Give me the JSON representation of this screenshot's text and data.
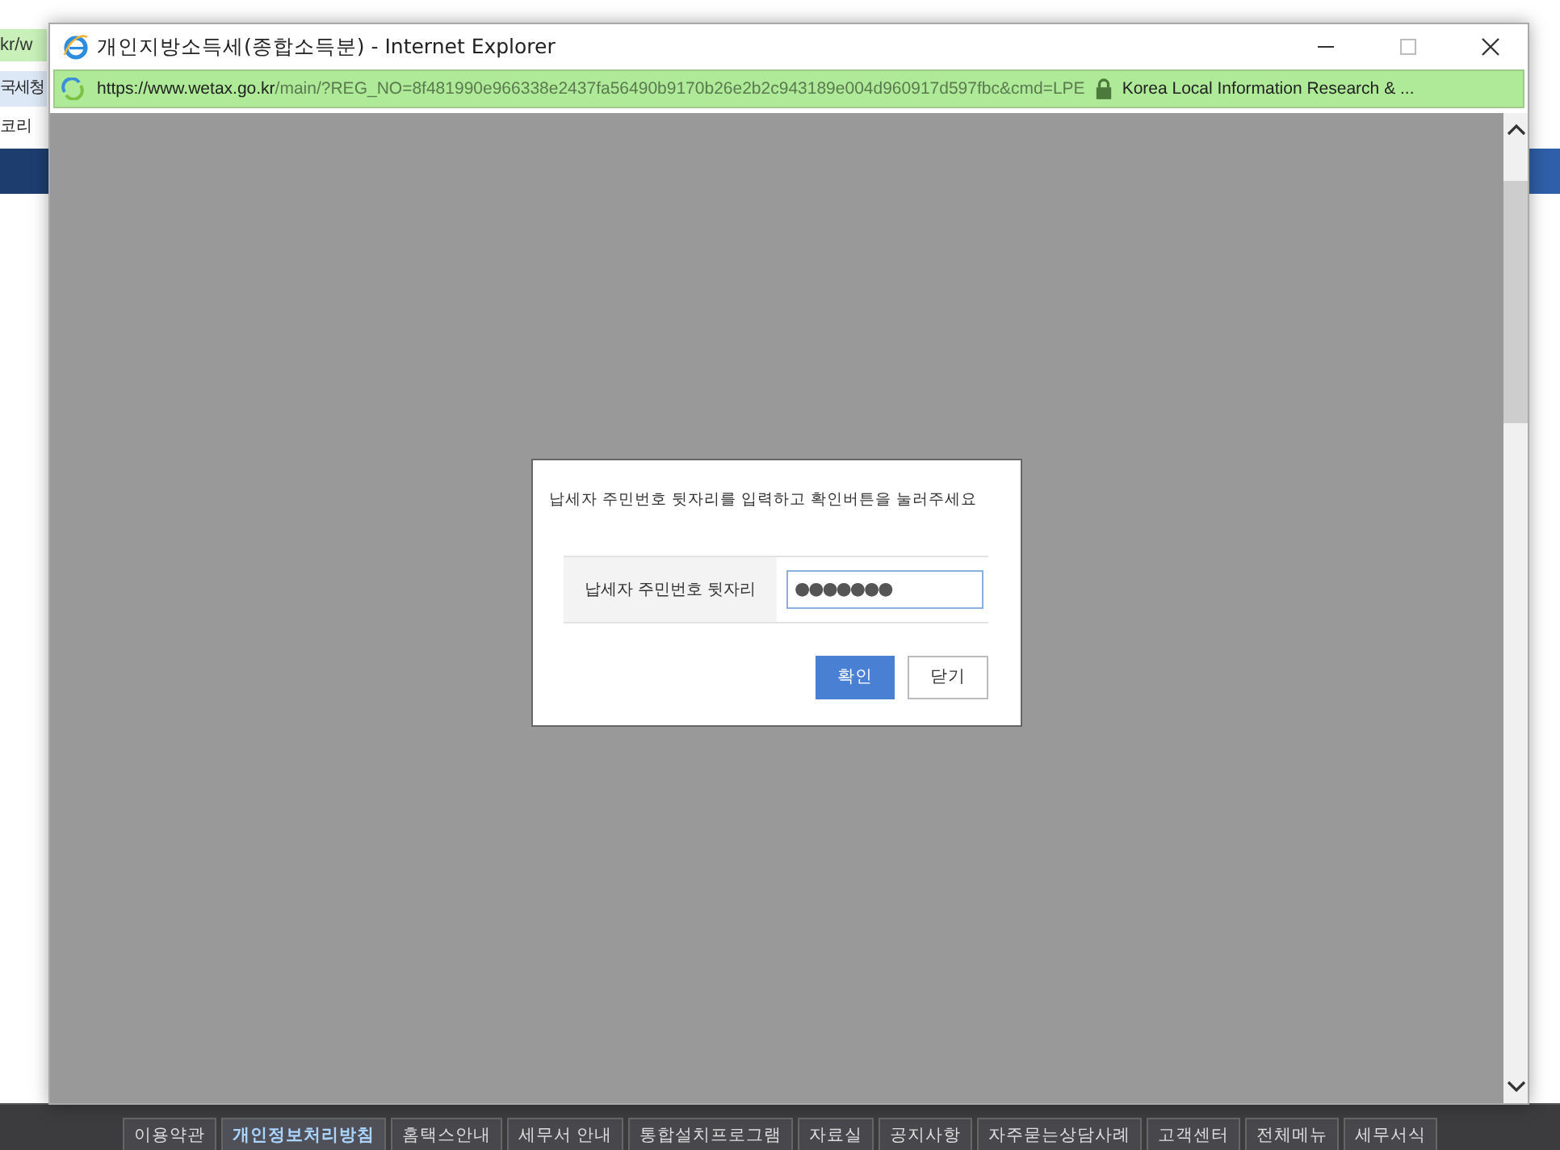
{
  "background_page": {
    "address_fragment": "kr/w",
    "nav_text": "국세청",
    "line_text": "코리"
  },
  "window": {
    "title": "개인지방소득세(종합소득분) - Internet Explorer",
    "url_host": "https://www.wetax.go.kr",
    "url_path": "/main/?REG_NO=8f481990e966338e2437fa56490b9170b26e2b2c943189e004d960917d597fbc&cmd=LPE",
    "certificate": "Korea Local Information Research & ..."
  },
  "dialog": {
    "message": "납세자 주민번호 뒷자리를 입력하고 확인버튼을 눌러주세요",
    "field_label": "납세자 주민번호 뒷자리",
    "field_value": "●●●●●●●",
    "buttons": [
      {
        "label": "확인",
        "kind": "primary"
      },
      {
        "label": "닫기",
        "kind": "secondary"
      }
    ]
  },
  "footer_links": [
    {
      "label": "이용약관",
      "selected": false
    },
    {
      "label": "개인정보처리방침",
      "selected": true
    },
    {
      "label": "홈택스안내",
      "selected": false
    },
    {
      "label": "세무서 안내",
      "selected": false
    },
    {
      "label": "통합설치프로그램",
      "selected": false
    },
    {
      "label": "자료실",
      "selected": false
    },
    {
      "label": "공지사항",
      "selected": false
    },
    {
      "label": "자주묻는상담사례",
      "selected": false
    },
    {
      "label": "고객센터",
      "selected": false
    },
    {
      "label": "전체메뉴",
      "selected": false
    },
    {
      "label": "세무서식",
      "selected": false
    }
  ]
}
